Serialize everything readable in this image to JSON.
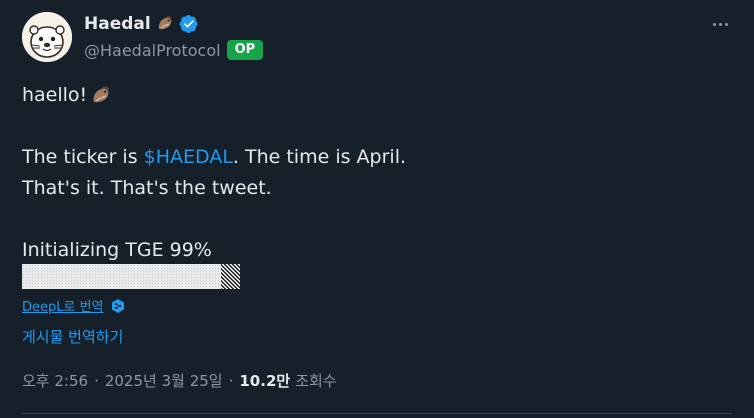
{
  "colors": {
    "background": "#15202b",
    "text": "#e7e9ea",
    "secondary": "#8b98a5",
    "link": "#1d9bf0",
    "op_badge": "#16a34a",
    "verified": "#1d9bf0"
  },
  "author": {
    "display_name": "Haedal",
    "name_emoji": "otter",
    "verified_icon": "verified-badge-icon",
    "handle": "@HaedalProtocol",
    "op_badge": "OP"
  },
  "tweet": {
    "line1": "haello! ",
    "line1_emoji": "otter",
    "line2_before": "The ticker is ",
    "cashtag": "$HAEDAL",
    "line2_after": ". The time is April.",
    "line3": "That's it. That's the tweet.",
    "line4": "Initializing TGE 99%",
    "progress_percent": 99
  },
  "translation": {
    "deepl_link": "DeepL로 번역",
    "deepl_icon": "deepl-icon",
    "translate_post": "게시물 번역하기"
  },
  "meta": {
    "time": "오후 2:56",
    "date": "2025년 3월 25일",
    "separator": "·",
    "views_count": "10.2만",
    "views_label": "조회수"
  },
  "more_icon": "more-horizontal-icon"
}
